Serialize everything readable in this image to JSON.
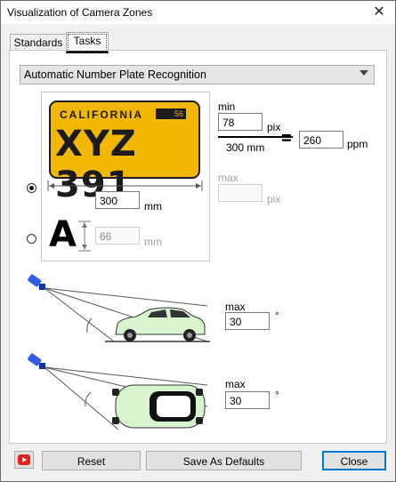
{
  "window": {
    "title": "Visualization of Camera Zones"
  },
  "tabs": [
    {
      "label": "Standards"
    },
    {
      "label": "Tasks"
    }
  ],
  "task_select": {
    "value": "Automatic Number Plate Recognition"
  },
  "plate": {
    "state": "CALIFORNIA",
    "sticker": "56",
    "number": "XYZ 391"
  },
  "size": {
    "plate_width_value": "300",
    "plate_width_unit": "mm",
    "char_height_value": "66",
    "char_height_unit": "mm",
    "char_symbol": "A"
  },
  "resolution": {
    "min_label": "min",
    "min_value": "78",
    "pix_unit": "pix",
    "denominator": "300 mm",
    "equals": "=",
    "ppm_value": "260",
    "ppm_unit": "ppm",
    "max_label": "max",
    "max_value": "",
    "max_unit": "pix"
  },
  "angles": {
    "vertical": {
      "label": "max",
      "value": "30",
      "unit": "°"
    },
    "horizontal": {
      "label": "max",
      "value": "30",
      "unit": "°"
    }
  },
  "footer": {
    "youtube_icon": "youtube-icon",
    "reset": "Reset",
    "save_defaults": "Save As Defaults",
    "close": "Close"
  },
  "colors": {
    "plate": "#f2b705",
    "camera": "#2f5fe8",
    "car_body": "#d8f5d0",
    "accent": "#0078d7"
  }
}
